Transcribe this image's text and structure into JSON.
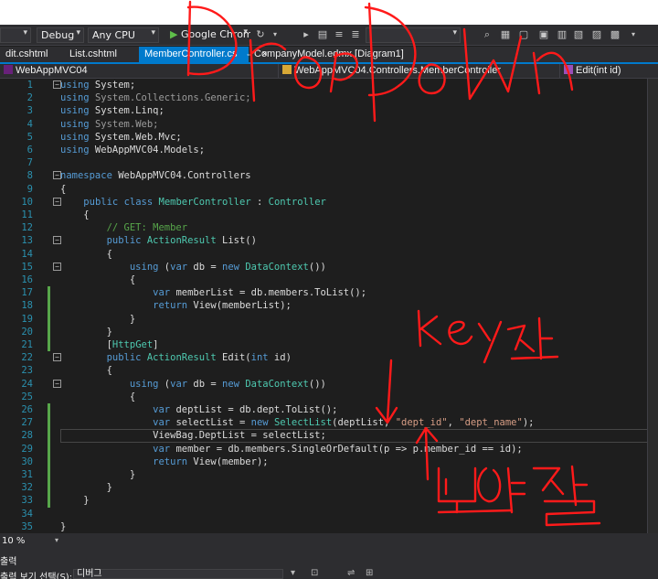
{
  "toolbar": {
    "config": "Debug",
    "platform": "Any CPU",
    "run_target": "Google Chrome"
  },
  "tabs": [
    {
      "label": "dit.cshtml"
    },
    {
      "label": "List.cshtml"
    },
    {
      "label": "MemberController.cs",
      "pin": "⇔",
      "close": "×"
    },
    {
      "label": "CompanyModel.edmx [Diagram1]"
    }
  ],
  "navbar": {
    "project": "WebAppMVC04",
    "class": "WebAppMVC04.Controllers.MemberController",
    "member": "Edit(int id)"
  },
  "code_lines": [
    {
      "n": "1",
      "html": "<span class='kw'>using</span> System;"
    },
    {
      "n": "2",
      "html": "<span class='kw'>using</span> <span class='dim'>System.Collections.Generic;</span>"
    },
    {
      "n": "3",
      "html": "<span class='kw'>using</span> System.Linq;"
    },
    {
      "n": "4",
      "html": "<span class='kw'>using</span> <span class='dim'>System.Web;</span>"
    },
    {
      "n": "5",
      "html": "<span class='kw'>using</span> System.Web.Mvc;"
    },
    {
      "n": "6",
      "html": "<span class='kw'>using</span> WebAppMVC04.Models;"
    },
    {
      "n": "7",
      "html": ""
    },
    {
      "n": "8",
      "html": "<span class='kw'>namespace</span> WebAppMVC04.Controllers"
    },
    {
      "n": "9",
      "html": "{"
    },
    {
      "n": "10",
      "html": "    <span class='kw'>public</span> <span class='kw'>class</span> <span class='ty'>MemberController</span> : <span class='ty'>Controller</span>"
    },
    {
      "n": "11",
      "html": "    {"
    },
    {
      "n": "12",
      "html": "        <span class='cm'>// GET: Member</span>"
    },
    {
      "n": "13",
      "html": "        <span class='kw'>public</span> <span class='ty'>ActionResult</span> List()"
    },
    {
      "n": "14",
      "html": "        {"
    },
    {
      "n": "15",
      "html": "            <span class='kw'>using</span> (<span class='kw'>var</span> db = <span class='kw'>new</span> <span class='ty'>DataContext</span>())"
    },
    {
      "n": "16",
      "html": "            {"
    },
    {
      "n": "17",
      "html": "                <span class='kw'>var</span> memberList = db.members.ToList();"
    },
    {
      "n": "18",
      "html": "                <span class='kw'>return</span> View(memberList);"
    },
    {
      "n": "19",
      "html": "            }"
    },
    {
      "n": "20",
      "html": "        }"
    },
    {
      "n": "21",
      "html": "        [<span class='at'>HttpGet</span>]"
    },
    {
      "n": "22",
      "html": "        <span class='kw'>public</span> <span class='ty'>ActionResult</span> Edit(<span class='kw'>int</span> id)"
    },
    {
      "n": "23",
      "html": "        {"
    },
    {
      "n": "24",
      "html": "            <span class='kw'>using</span> (<span class='kw'>var</span> db = <span class='kw'>new</span> <span class='ty'>DataContext</span>())"
    },
    {
      "n": "25",
      "html": "            {"
    },
    {
      "n": "26",
      "html": "                <span class='kw'>var</span> deptList = db.dept.ToList();"
    },
    {
      "n": "27",
      "html": "                <span class='kw'>var</span> selectList = <span class='kw'>new</span> <span class='ty'>SelectList</span>(deptList, <span class='st'>\"dept_id\"</span>, <span class='st'>\"dept_name\"</span>);"
    },
    {
      "n": "28",
      "html": "                ViewBag.DeptList = selectList;"
    },
    {
      "n": "29",
      "html": "                <span class='kw'>var</span> member = db.members.SingleOrDefault(p =&gt; p.member_id == id);"
    },
    {
      "n": "30",
      "html": "                <span class='kw'>return</span> View(member);"
    },
    {
      "n": "31",
      "html": "            }"
    },
    {
      "n": "32",
      "html": "        }"
    },
    {
      "n": "33",
      "html": "    }"
    },
    {
      "n": "34",
      "html": ""
    },
    {
      "n": "35",
      "html": "}"
    }
  ],
  "status": {
    "zoom": "10 %",
    "output_title": "출력",
    "output_source_label": "출력 보기 선택(S):",
    "output_source_value": "디버그"
  },
  "annotations": {
    "drop_down": "Drop Down",
    "key_value": "key 값",
    "to_show": "보여질"
  },
  "colors": {
    "accent": "#007acc",
    "annotation": "#ff1a1a"
  }
}
